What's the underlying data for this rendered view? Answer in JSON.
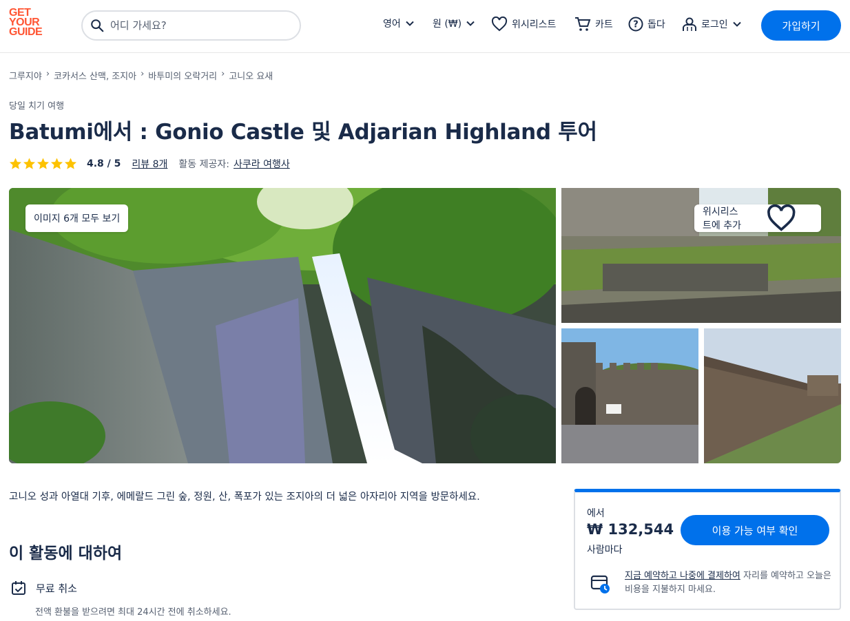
{
  "header": {
    "logo": [
      "GET",
      "YOUR",
      "GUIDE"
    ],
    "search_placeholder": "어디 가세요?",
    "language": "영어",
    "currency": "원 (₩)",
    "wishlist": "위시리스트",
    "cart": "카트",
    "help": "돕다",
    "login": "로그인",
    "signup": "가입하기"
  },
  "breadcrumb": [
    "그루지야",
    "코카서스 산맥, 조지아",
    "바투미의 오락거리",
    "고니오 요새"
  ],
  "activity": {
    "category": "당일 치기 여행",
    "title": "Batumi에서 : Gonio Castle 및 Adjarian Highland 투어",
    "stars": 5,
    "rating": "4.8 / 5",
    "reviews": "리뷰 8개",
    "provider_label": "활동 제공자:",
    "provider": "사쿠라 여행사"
  },
  "gallery": {
    "view_all": "이미지 6개 모두 보기",
    "add_wishlist": "위시리스트에 추가"
  },
  "description": "고니오 성과 아열대 기후, 에메랄드 그린 숲, 정원, 산, 폭포가 있는 조지아의 더 넓은 아자리아 지역을 방문하세요.",
  "about": {
    "heading": "이 활동에 대하여",
    "feature_title": "무료 취소",
    "feature_sub": "전액 환불을 받으려면 최대 24시간 전에 취소하세요."
  },
  "booking": {
    "from": "에서",
    "price": "₩ 132,544",
    "per": "사람마다",
    "check_button": "이용 가능 여부 확인",
    "rnpl_link": "지금 예약하고 나중에 결제하여",
    "rnpl_text": " 자리를 예약하고 오늘은 비용을 지불하지 마세요."
  },
  "colors": {
    "brand": "#ff5533",
    "primary": "#0071eb",
    "star": "#fdc200",
    "text": "#1a2b49"
  }
}
